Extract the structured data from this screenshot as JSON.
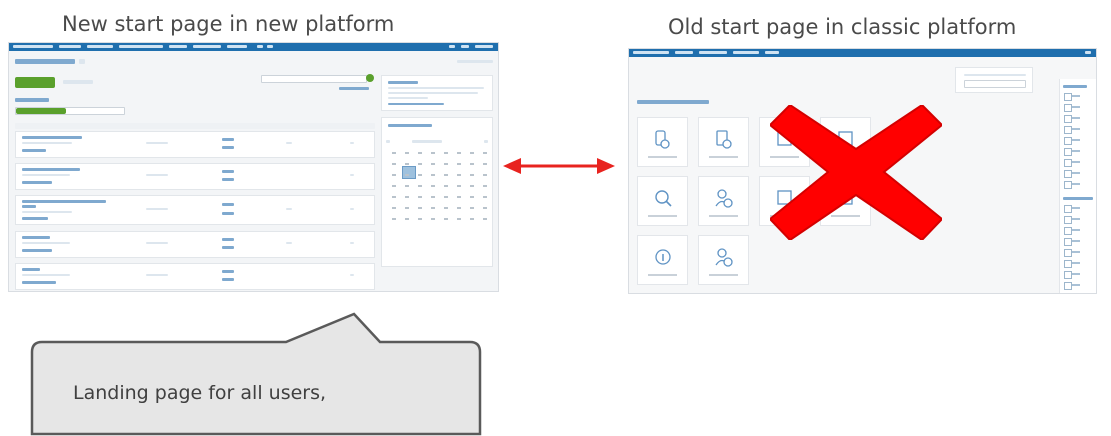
{
  "captions": {
    "left": "New start page in new platform",
    "right": "Old start page in classic platform"
  },
  "callout": {
    "text": "Landing page for all users,"
  },
  "colors": {
    "arrow": "#e8231f",
    "cross": "#ff0000",
    "callout_fill": "#e6e6e6",
    "callout_border": "#5a5a5a",
    "platform_bar": "#1f6fae",
    "accent_green": "#5aa02c"
  },
  "icons": {
    "connector": "double-headed-arrow",
    "rejection": "red-x-mark"
  }
}
